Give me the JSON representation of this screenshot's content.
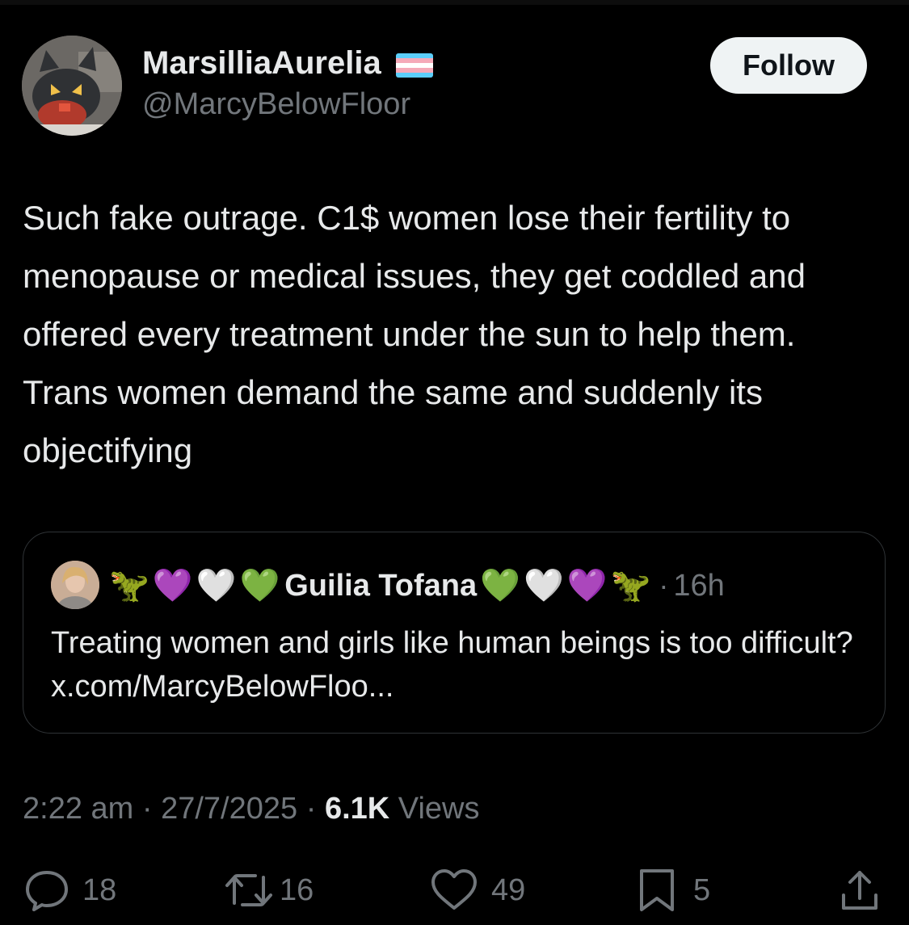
{
  "author": {
    "display_name": "MarsilliaAurelia",
    "handle": "@MarcyBelowFloor",
    "flag": "transgender-flag",
    "avatar": "cat-avatar"
  },
  "follow_label": "Follow",
  "tweet_text": "Such fake outrage. C1$ women lose their fertility to menopause or medical issues, they get coddled and offered every treatment under the sun to help them. Trans women demand the same and suddenly its objectifying",
  "quote": {
    "emoji_prefix": [
      "🦖",
      "💜",
      "🤍",
      "💚"
    ],
    "name": "Guilia Tofana",
    "emoji_suffix": [
      "💚",
      "🤍",
      "💜",
      "🦖"
    ],
    "separator": "·",
    "time": "16h",
    "text": "Treating women and girls like human beings is too difficult? x.com/MarcyBelowFloo..."
  },
  "meta": {
    "time": "2:22 am",
    "date": "27/7/2025",
    "separator": "·",
    "views_count": "6.1K",
    "views_label": "Views"
  },
  "actions": {
    "replies": "18",
    "reposts": "16",
    "likes": "49",
    "bookmarks": "5"
  },
  "colors": {
    "background": "#000000",
    "text": "#e7e9ea",
    "muted": "#71767b",
    "border": "#2f3336",
    "follow_bg": "#eff3f4",
    "flag_blue": "#5BCEFA",
    "flag_pink": "#F5A9B8",
    "flag_white": "#FFFFFF"
  }
}
